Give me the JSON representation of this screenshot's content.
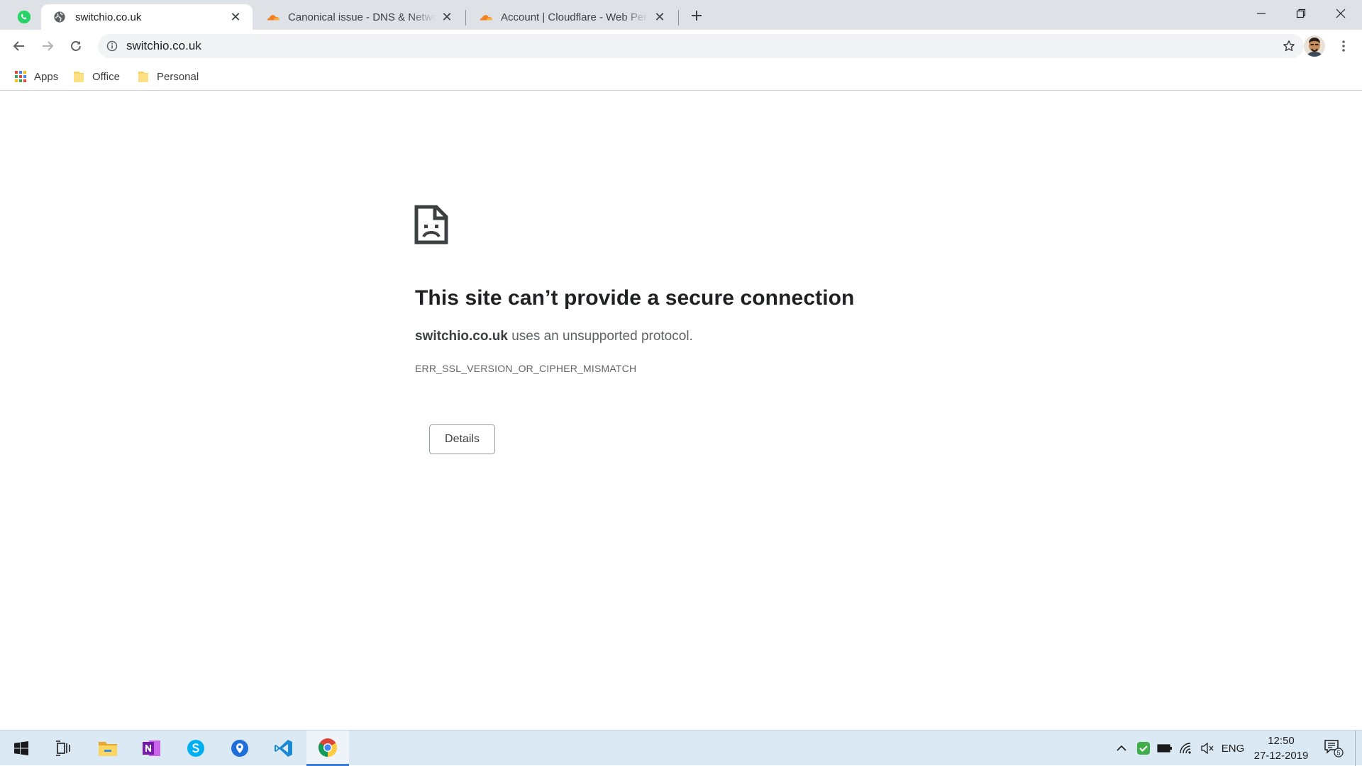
{
  "tabs": [
    {
      "title": "switchio.co.uk",
      "active": true,
      "icon": "globe-icon"
    },
    {
      "title": "Canonical issue - DNS & Network",
      "active": false,
      "icon": "cloudflare-icon"
    },
    {
      "title": "Account | Cloudflare - Web Performance",
      "active": false,
      "icon": "cloudflare-icon"
    }
  ],
  "address_bar": {
    "url": "switchio.co.uk"
  },
  "bookmarks": [
    {
      "label": "Apps",
      "icon": "apps-grid-icon"
    },
    {
      "label": "Office",
      "icon": "folder-icon"
    },
    {
      "label": "Personal",
      "icon": "folder-icon"
    }
  ],
  "error": {
    "title": "This site can’t provide a secure connection",
    "host": "switchio.co.uk",
    "message": " uses an unsupported protocol.",
    "code": "ERR_SSL_VERSION_OR_CIPHER_MISMATCH",
    "details_label": "Details"
  },
  "taskbar": {
    "language": "ENG",
    "time": "12:50",
    "date": "27-12-2019",
    "notification_count": "5"
  },
  "colors": {
    "tabstrip": "#dee1e6",
    "omnibox": "#f1f3f4",
    "taskbar": "#dbe9f4",
    "cloudflare_orange": "#f38020"
  }
}
